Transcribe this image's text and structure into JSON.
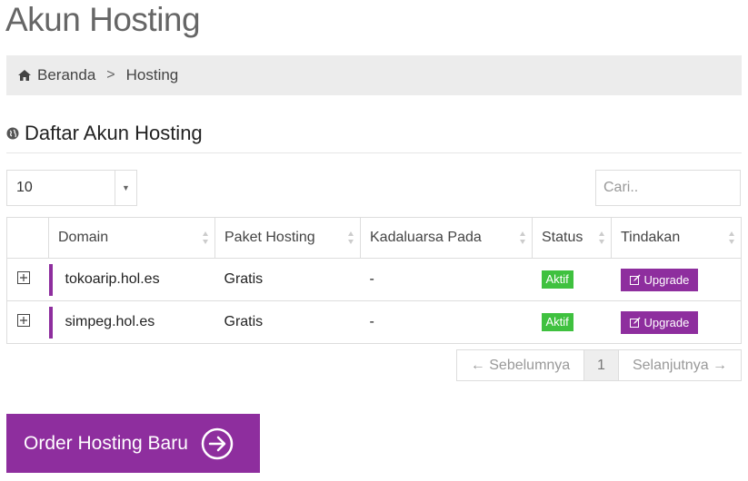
{
  "page": {
    "title": "Akun Hosting"
  },
  "breadcrumb": {
    "home": "Beranda",
    "separator": ">",
    "current": "Hosting"
  },
  "section": {
    "title": "Daftar Akun Hosting"
  },
  "controls": {
    "length_value": "10",
    "search_placeholder": "Cari.."
  },
  "table": {
    "headers": [
      "",
      "Domain",
      "Paket Hosting",
      "Kadaluarsa Pada",
      "Status",
      "Tindakan"
    ],
    "rows": [
      {
        "domain": "tokoarip.hol.es",
        "package": "Gratis",
        "expires": "-",
        "status": "Aktif",
        "action": "Upgrade"
      },
      {
        "domain": "simpeg.hol.es",
        "package": "Gratis",
        "expires": "-",
        "status": "Aktif",
        "action": "Upgrade"
      }
    ]
  },
  "pagination": {
    "prev": "← Sebelumnya",
    "page": "1",
    "next": "Selanjutnya →"
  },
  "order_button": {
    "label": "Order Hosting Baru"
  },
  "colors": {
    "accent": "#8e2e9e",
    "status_active": "#3fc13f",
    "breadcrumb_bg": "#ececec"
  },
  "icons": [
    "home-icon",
    "globe-icon",
    "expand-icon",
    "edit-icon",
    "arrow-right-circle-icon",
    "sort-icon",
    "chevron-down-icon"
  ]
}
